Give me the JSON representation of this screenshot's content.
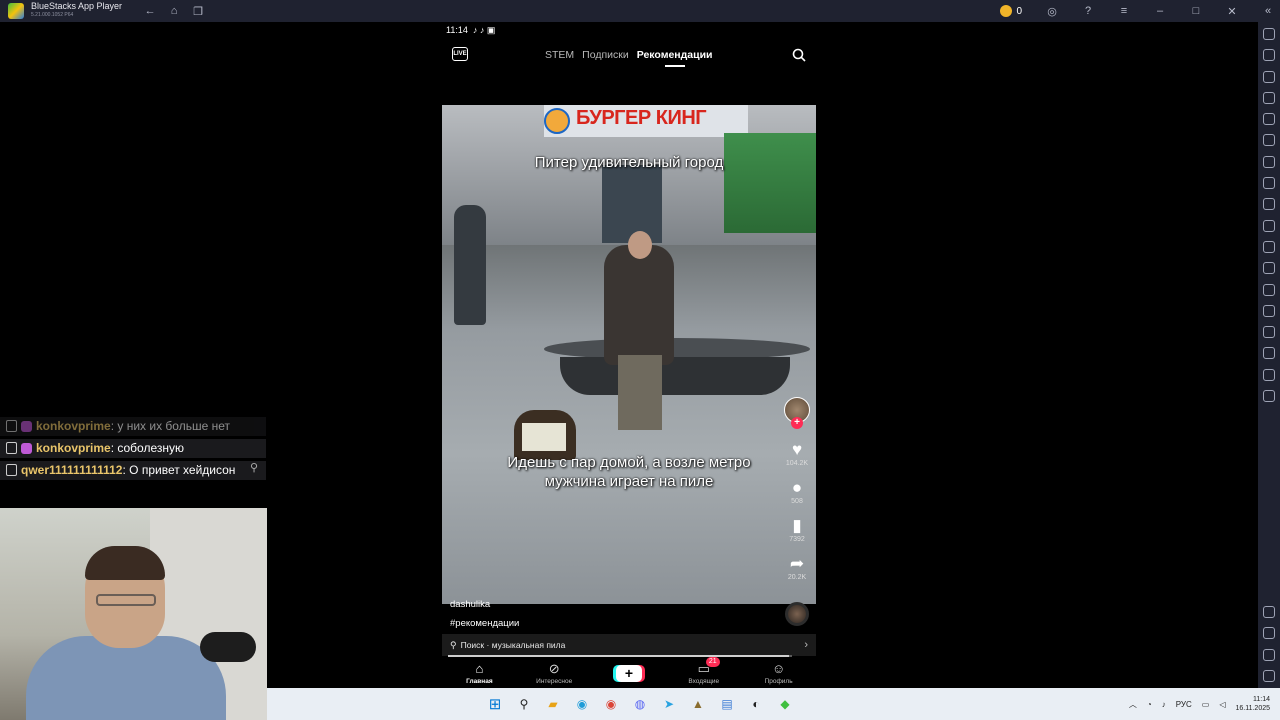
{
  "window": {
    "title": "BlueStacks App Player",
    "version": "5.21.000.1052 P64",
    "coins": "0"
  },
  "phone": {
    "status_time": "11:14",
    "live_label": "LIVE",
    "tabs": [
      "STEM",
      "Подписки",
      "Рекомендации"
    ],
    "active_tab": "Рекомендации"
  },
  "video": {
    "sign_text": "БУРГЕР КИНГ",
    "caption_top": "Питер удивительный город",
    "caption_bottom": "Идешь с пар домой, а возле метро мужчина играет на пиле",
    "username": "dashulika",
    "hashtag": "#рекомендации",
    "progress": 0.99,
    "actions": {
      "likes": "104.2K",
      "comments": "508",
      "saves": "7392",
      "shares": "20.2K"
    }
  },
  "search_bar": {
    "prefix": "Поиск",
    "query": "музыкальная пила",
    "separator": " · "
  },
  "nav": {
    "home": "Главная",
    "discover": "Интересное",
    "create": "+",
    "inbox": "Входящие",
    "inbox_badge": "21",
    "profile": "Профиль"
  },
  "chat": {
    "messages": [
      {
        "user": "konkovprime",
        "text": "у них их больше нет"
      },
      {
        "user": "konkovprime",
        "text": "соболезную"
      },
      {
        "user": "qwer111111111112",
        "text": "О привет хейдисон"
      }
    ]
  },
  "taskbar": {
    "lang": "РУС",
    "time": "11:14",
    "date": "16.11.2025"
  },
  "colors": {
    "titlebar": "#1f2230",
    "tiktok_red": "#fe2c55",
    "tiktok_cyan": "#25f4ee",
    "chat_user": "#e9c56a"
  }
}
